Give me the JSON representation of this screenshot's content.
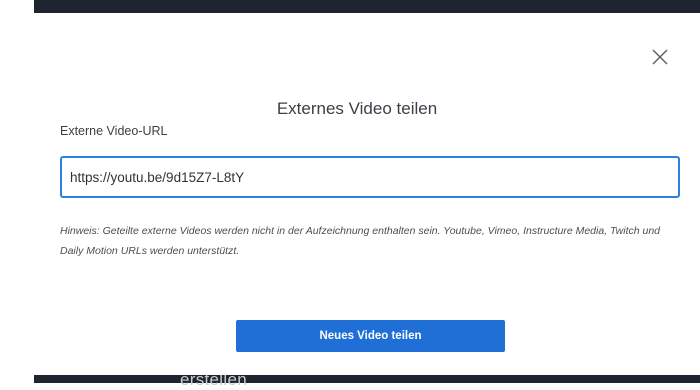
{
  "background": {
    "partial_text": "erstellen"
  },
  "dialog": {
    "title": "Externes Video teilen",
    "close_icon": "close-icon",
    "url_label": "Externe Video-URL",
    "url_value": "https://youtu.be/9d15Z7-L8tY",
    "hint": "Hinweis: Geteilte externe Videos werden nicht in der Aufzeichnung enthalten sein. Youtube, Vimeo, Instructure Media, Twitch und Daily Motion URLs werden unterstützt.",
    "submit_label": "Neues Video teilen"
  },
  "colors": {
    "accent": "#1f6fd6",
    "input_focus_border": "#2d7ee5",
    "backdrop": "#1e2430"
  }
}
